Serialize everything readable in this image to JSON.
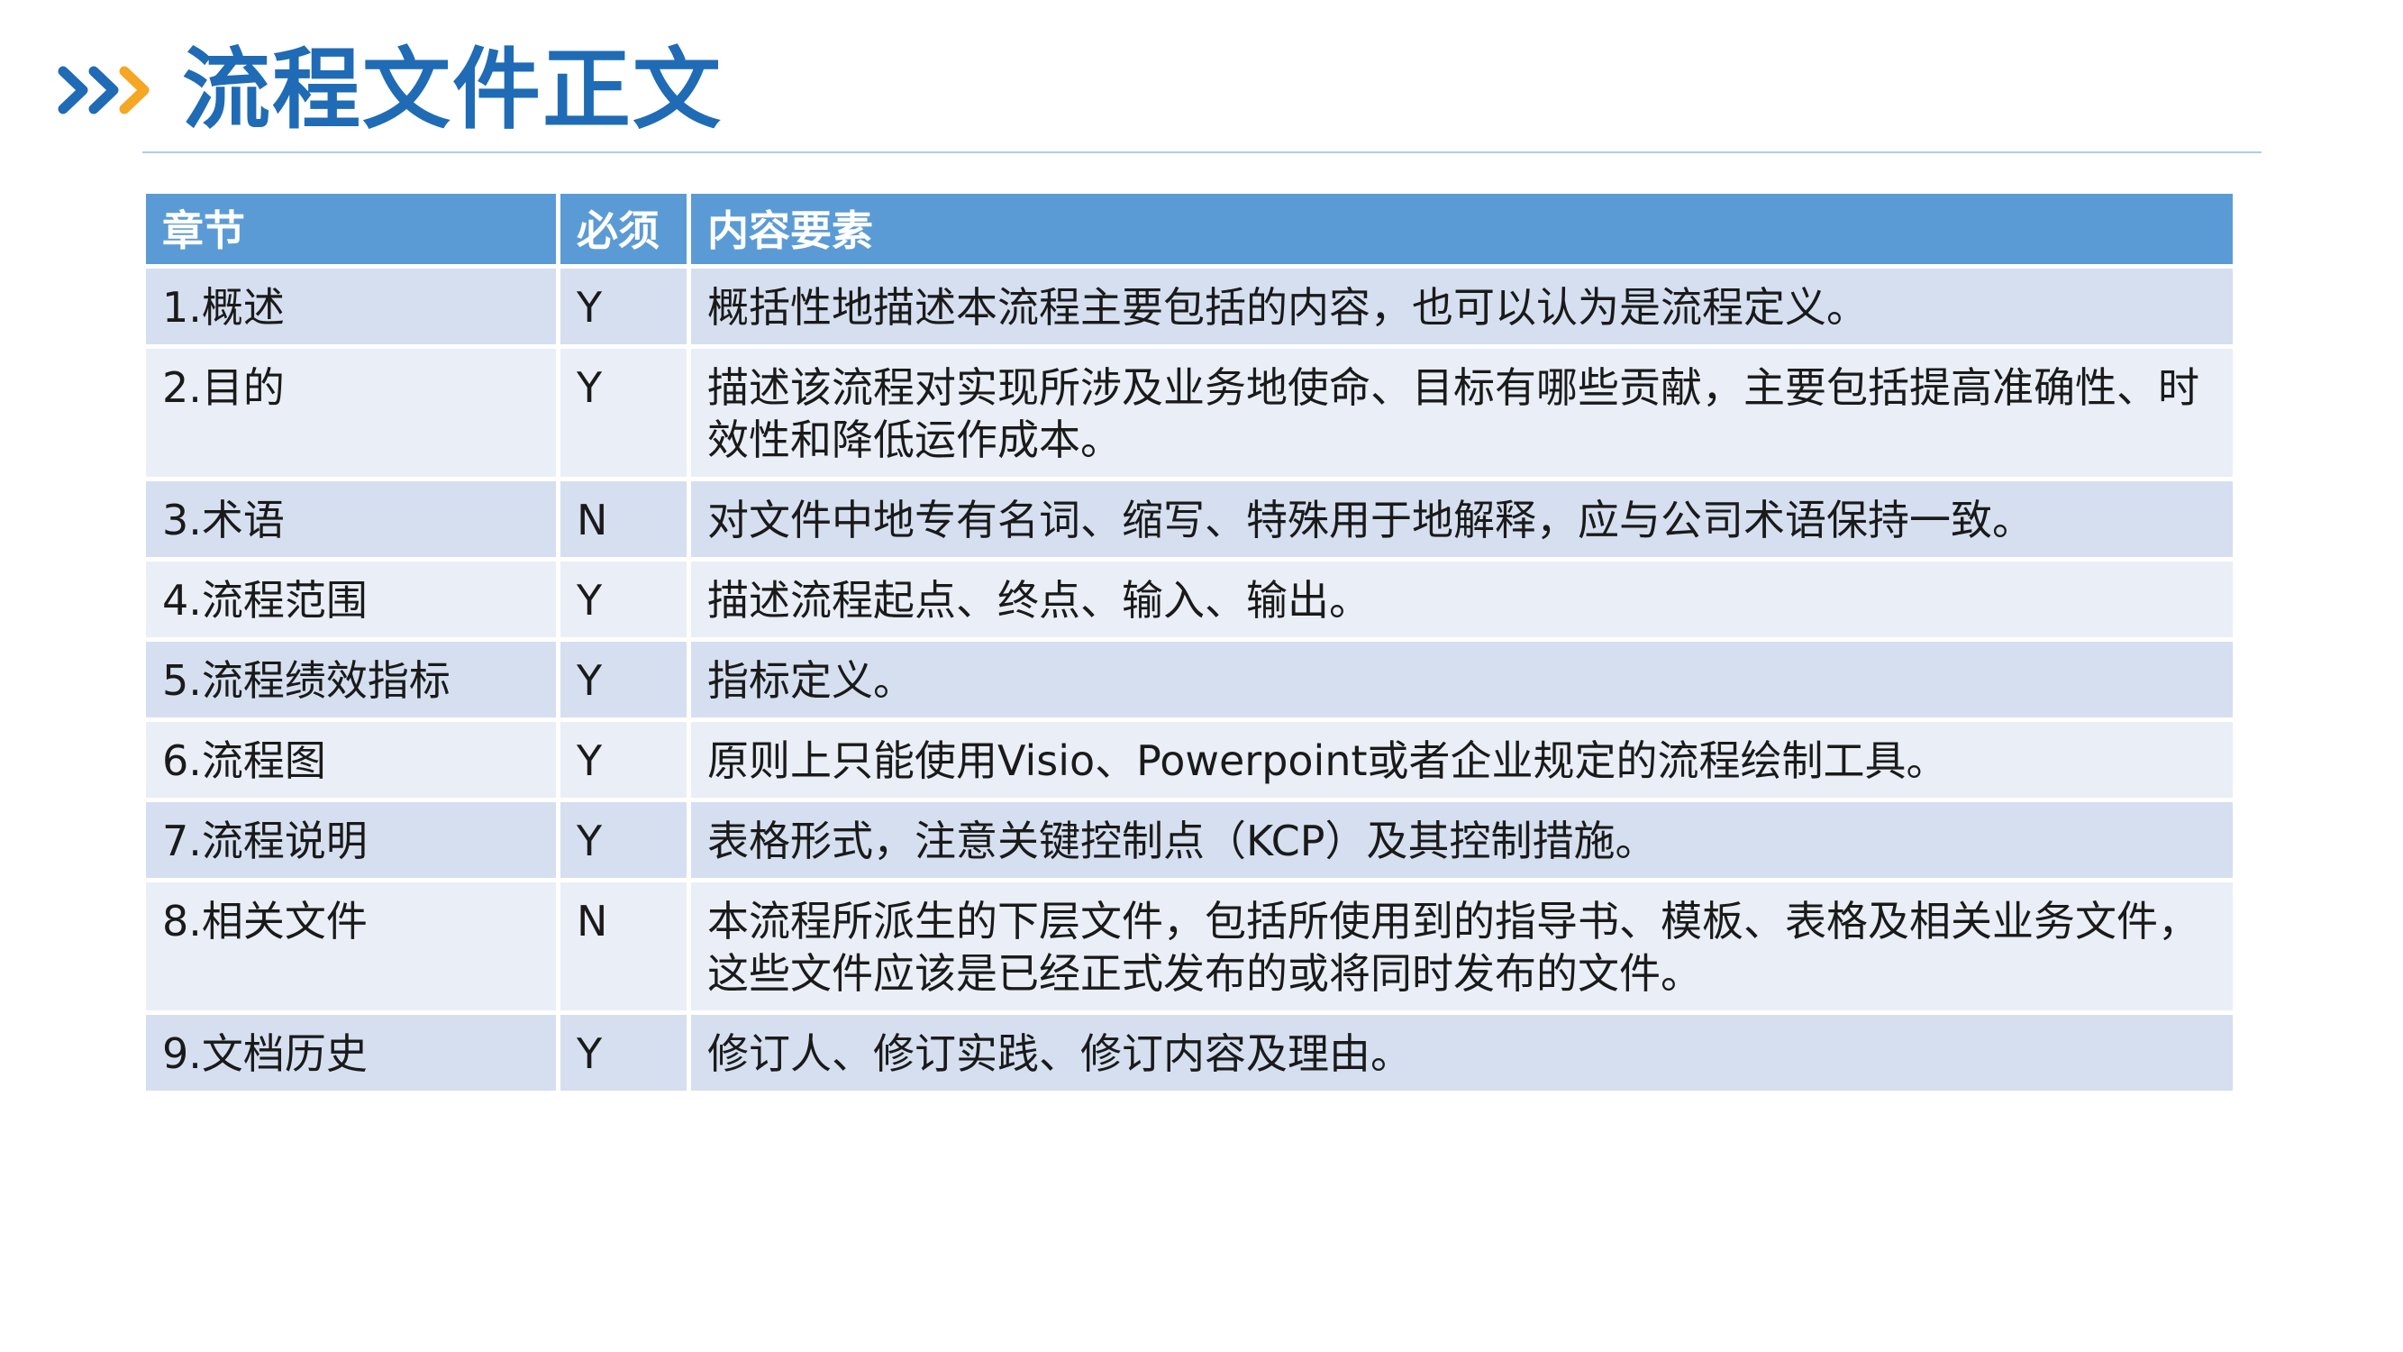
{
  "header": {
    "title": "流程文件正文",
    "colors": {
      "accent_blue": "#1F6BB5",
      "accent_orange": "#F5A623",
      "divider": "#A9CFEA"
    },
    "icon": "double-chevron-right-icon"
  },
  "table": {
    "columns": [
      "章节",
      "必须",
      "内容要素"
    ],
    "header_color": "#5B9BD5",
    "band_colors": [
      "#D5DFEF",
      "#E9EEF7"
    ],
    "rows": [
      {
        "section": "1.概述",
        "required": "Y",
        "content": "概括性地描述本流程主要包括的内容，也可以认为是流程定义。"
      },
      {
        "section": "2.目的",
        "required": "Y",
        "content": "描述该流程对实现所涉及业务地使命、目标有哪些贡献，主要包括提高准确性、时效性和降低运作成本。"
      },
      {
        "section": "3.术语",
        "required": "N",
        "content": "对文件中地专有名词、缩写、特殊用于地解释，应与公司术语保持一致。"
      },
      {
        "section": "4.流程范围",
        "required": "Y",
        "content": "描述流程起点、终点、输入、输出。"
      },
      {
        "section": "5.流程绩效指标",
        "required": "Y",
        "content": "指标定义。"
      },
      {
        "section": "6.流程图",
        "required": "Y",
        "content": "原则上只能使用Visio、Powerpoint或者企业规定的流程绘制工具。"
      },
      {
        "section": "7.流程说明",
        "required": "Y",
        "content": "表格形式，注意关键控制点（KCP）及其控制措施。"
      },
      {
        "section": "8.相关文件",
        "required": "N",
        "content": "本流程所派生的下层文件，包括所使用到的指导书、模板、表格及相关业务文件，这些文件应该是已经正式发布的或将同时发布的文件。"
      },
      {
        "section": "9.文档历史",
        "required": "Y",
        "content": "修订人、修订实践、修订内容及理由。"
      }
    ]
  }
}
